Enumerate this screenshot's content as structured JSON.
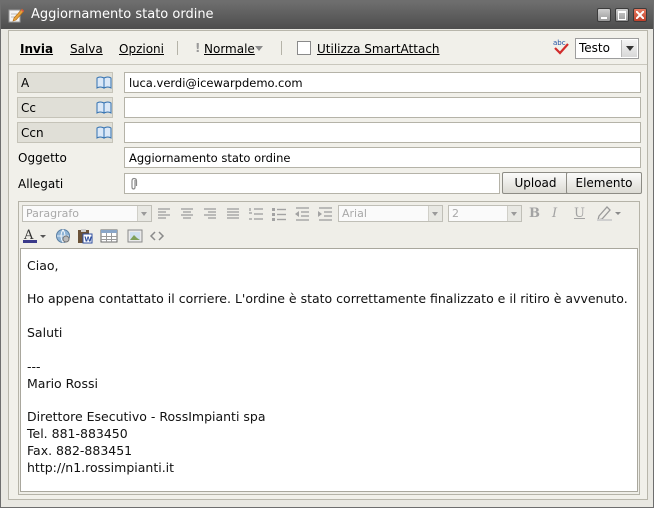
{
  "window": {
    "title": "Aggiornamento stato ordine"
  },
  "toolbar": {
    "send": "Invia",
    "save": "Salva",
    "options": "Opzioni",
    "priority": "Normale",
    "smartattach_label": "Utilizza SmartAttach",
    "smartattach_checked": false,
    "format": "Testo"
  },
  "recipients": {
    "to_label": "A",
    "to_value": "luca.verdi@icewarpdemo.com",
    "cc_label": "Cc",
    "cc_value": "",
    "bcc_label": "Ccn",
    "bcc_value": ""
  },
  "subject": {
    "label": "Oggetto",
    "value": "Aggiornamento stato ordine"
  },
  "attachments": {
    "label": "Allegati",
    "upload": "Upload",
    "item": "Elemento"
  },
  "editor": {
    "paragraph": "Paragrafo",
    "font": "Arial",
    "size": "2"
  },
  "message": {
    "lines": [
      "Ciao,",
      "Ho appena contattato il corriere. L'ordine è stato correttamente finalizzato e il ritiro è avvenuto.",
      "Saluti",
      "---",
      "Mario Rossi",
      "Direttore Esecutivo - RossImpianti spa",
      "Tel. 881-883450",
      "Fax. 882-883451",
      "http://n1.rossimpianti.it"
    ]
  },
  "colors": {
    "titlebar": "#5a5a5a",
    "accent_red": "#c0402a",
    "book_blue": "#2f6fb0"
  }
}
